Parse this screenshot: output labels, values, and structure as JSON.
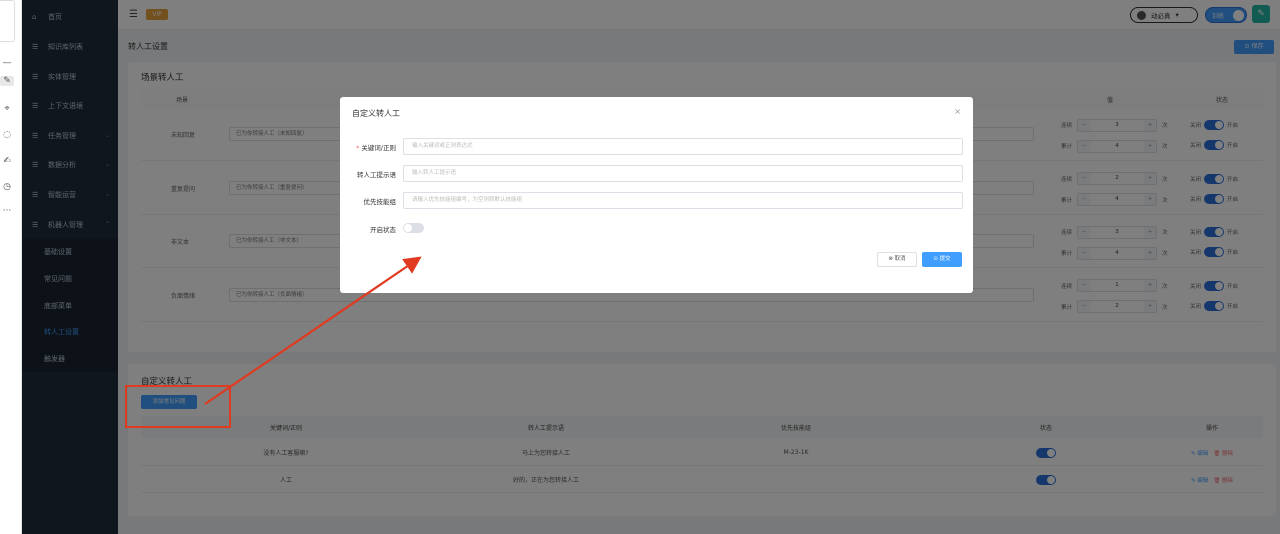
{
  "sidebar": {
    "items": [
      {
        "label": "首页",
        "icon": "home-icon",
        "expandable": false
      },
      {
        "label": "知识库列表",
        "icon": "list-icon",
        "expandable": false
      },
      {
        "label": "实体管理",
        "icon": "list-icon",
        "expandable": false
      },
      {
        "label": "上下文语境",
        "icon": "list-icon",
        "expandable": false
      },
      {
        "label": "任务管理",
        "icon": "list-icon",
        "expandable": true
      },
      {
        "label": "数据分析",
        "icon": "list-icon",
        "expandable": true
      },
      {
        "label": "智能运营",
        "icon": "list-icon",
        "expandable": true
      },
      {
        "label": "机器人管理",
        "icon": "list-icon",
        "expandable": true,
        "expanded": true
      }
    ],
    "subitems": [
      {
        "label": "基础设置",
        "active": false
      },
      {
        "label": "常见问题",
        "active": false
      },
      {
        "label": "底部菜单",
        "active": false
      },
      {
        "label": "转人工设置",
        "active": true
      },
      {
        "label": "触发器",
        "active": false
      }
    ]
  },
  "topbar": {
    "vip_badge": "VIP",
    "user_name": "动必真",
    "train_label": "训练"
  },
  "page": {
    "title": "转人工设置",
    "save_label": "保存"
  },
  "scene_section": {
    "title": "场景转人工",
    "headers": {
      "scene": "场景",
      "value": "值",
      "status": "状态"
    },
    "rows": [
      {
        "name": "未知回复",
        "prompt": "已为你转接人工（未知回复）",
        "consecutive": "3",
        "cumulative": "4"
      },
      {
        "name": "重复提问",
        "prompt": "已为你转接人工（重复提问）",
        "consecutive": "2",
        "cumulative": "4"
      },
      {
        "name": "非文本",
        "prompt": "已为你转接人工（非文本）",
        "consecutive": "3",
        "cumulative": "4"
      },
      {
        "name": "负面情绪",
        "prompt": "已为你转接人工（负面情绪）",
        "consecutive": "1",
        "cumulative": "2"
      }
    ],
    "labels": {
      "consecutive": "连续",
      "cumulative": "累计",
      "unit": "次",
      "off": "关闭",
      "on": "开启",
      "minus": "−",
      "plus": "+"
    }
  },
  "custom_section": {
    "title": "自定义转人工",
    "add_button": "添加常见问题",
    "headers": {
      "keyword": "关键词/正则",
      "prompt": "转人工提示语",
      "skill": "优先技能组",
      "status": "状态",
      "ops": "操作"
    },
    "rows": [
      {
        "keyword": "没有人工客服嘛?",
        "prompt": "马上为您转接人工",
        "skill": "M-23-1K",
        "status_on": true
      },
      {
        "keyword": "人工",
        "prompt": "好的，正在为您转接人工",
        "skill": "",
        "status_on": true
      }
    ],
    "edit_label": "编辑",
    "delete_label": "删除"
  },
  "modal": {
    "title": "自定义转人工",
    "close": "×",
    "fields": {
      "keyword_label": "关键词/正则",
      "keyword_placeholder": "输入关键词或正则表达式",
      "prompt_label": "转人工提示语",
      "prompt_placeholder": "输入转人工提示语",
      "skill_label": "优先技能组",
      "skill_placeholder": "请输入优先技能组编号，为空则转默认技能组",
      "status_label": "开启状态"
    },
    "cancel_label": "取消",
    "submit_label": "提交"
  },
  "colors": {
    "primary": "#409eff",
    "sidebar_bg": "#1f2d3d",
    "annotation": "#e03a20",
    "vip": "#e6a23c",
    "teal": "#23b7a6"
  }
}
